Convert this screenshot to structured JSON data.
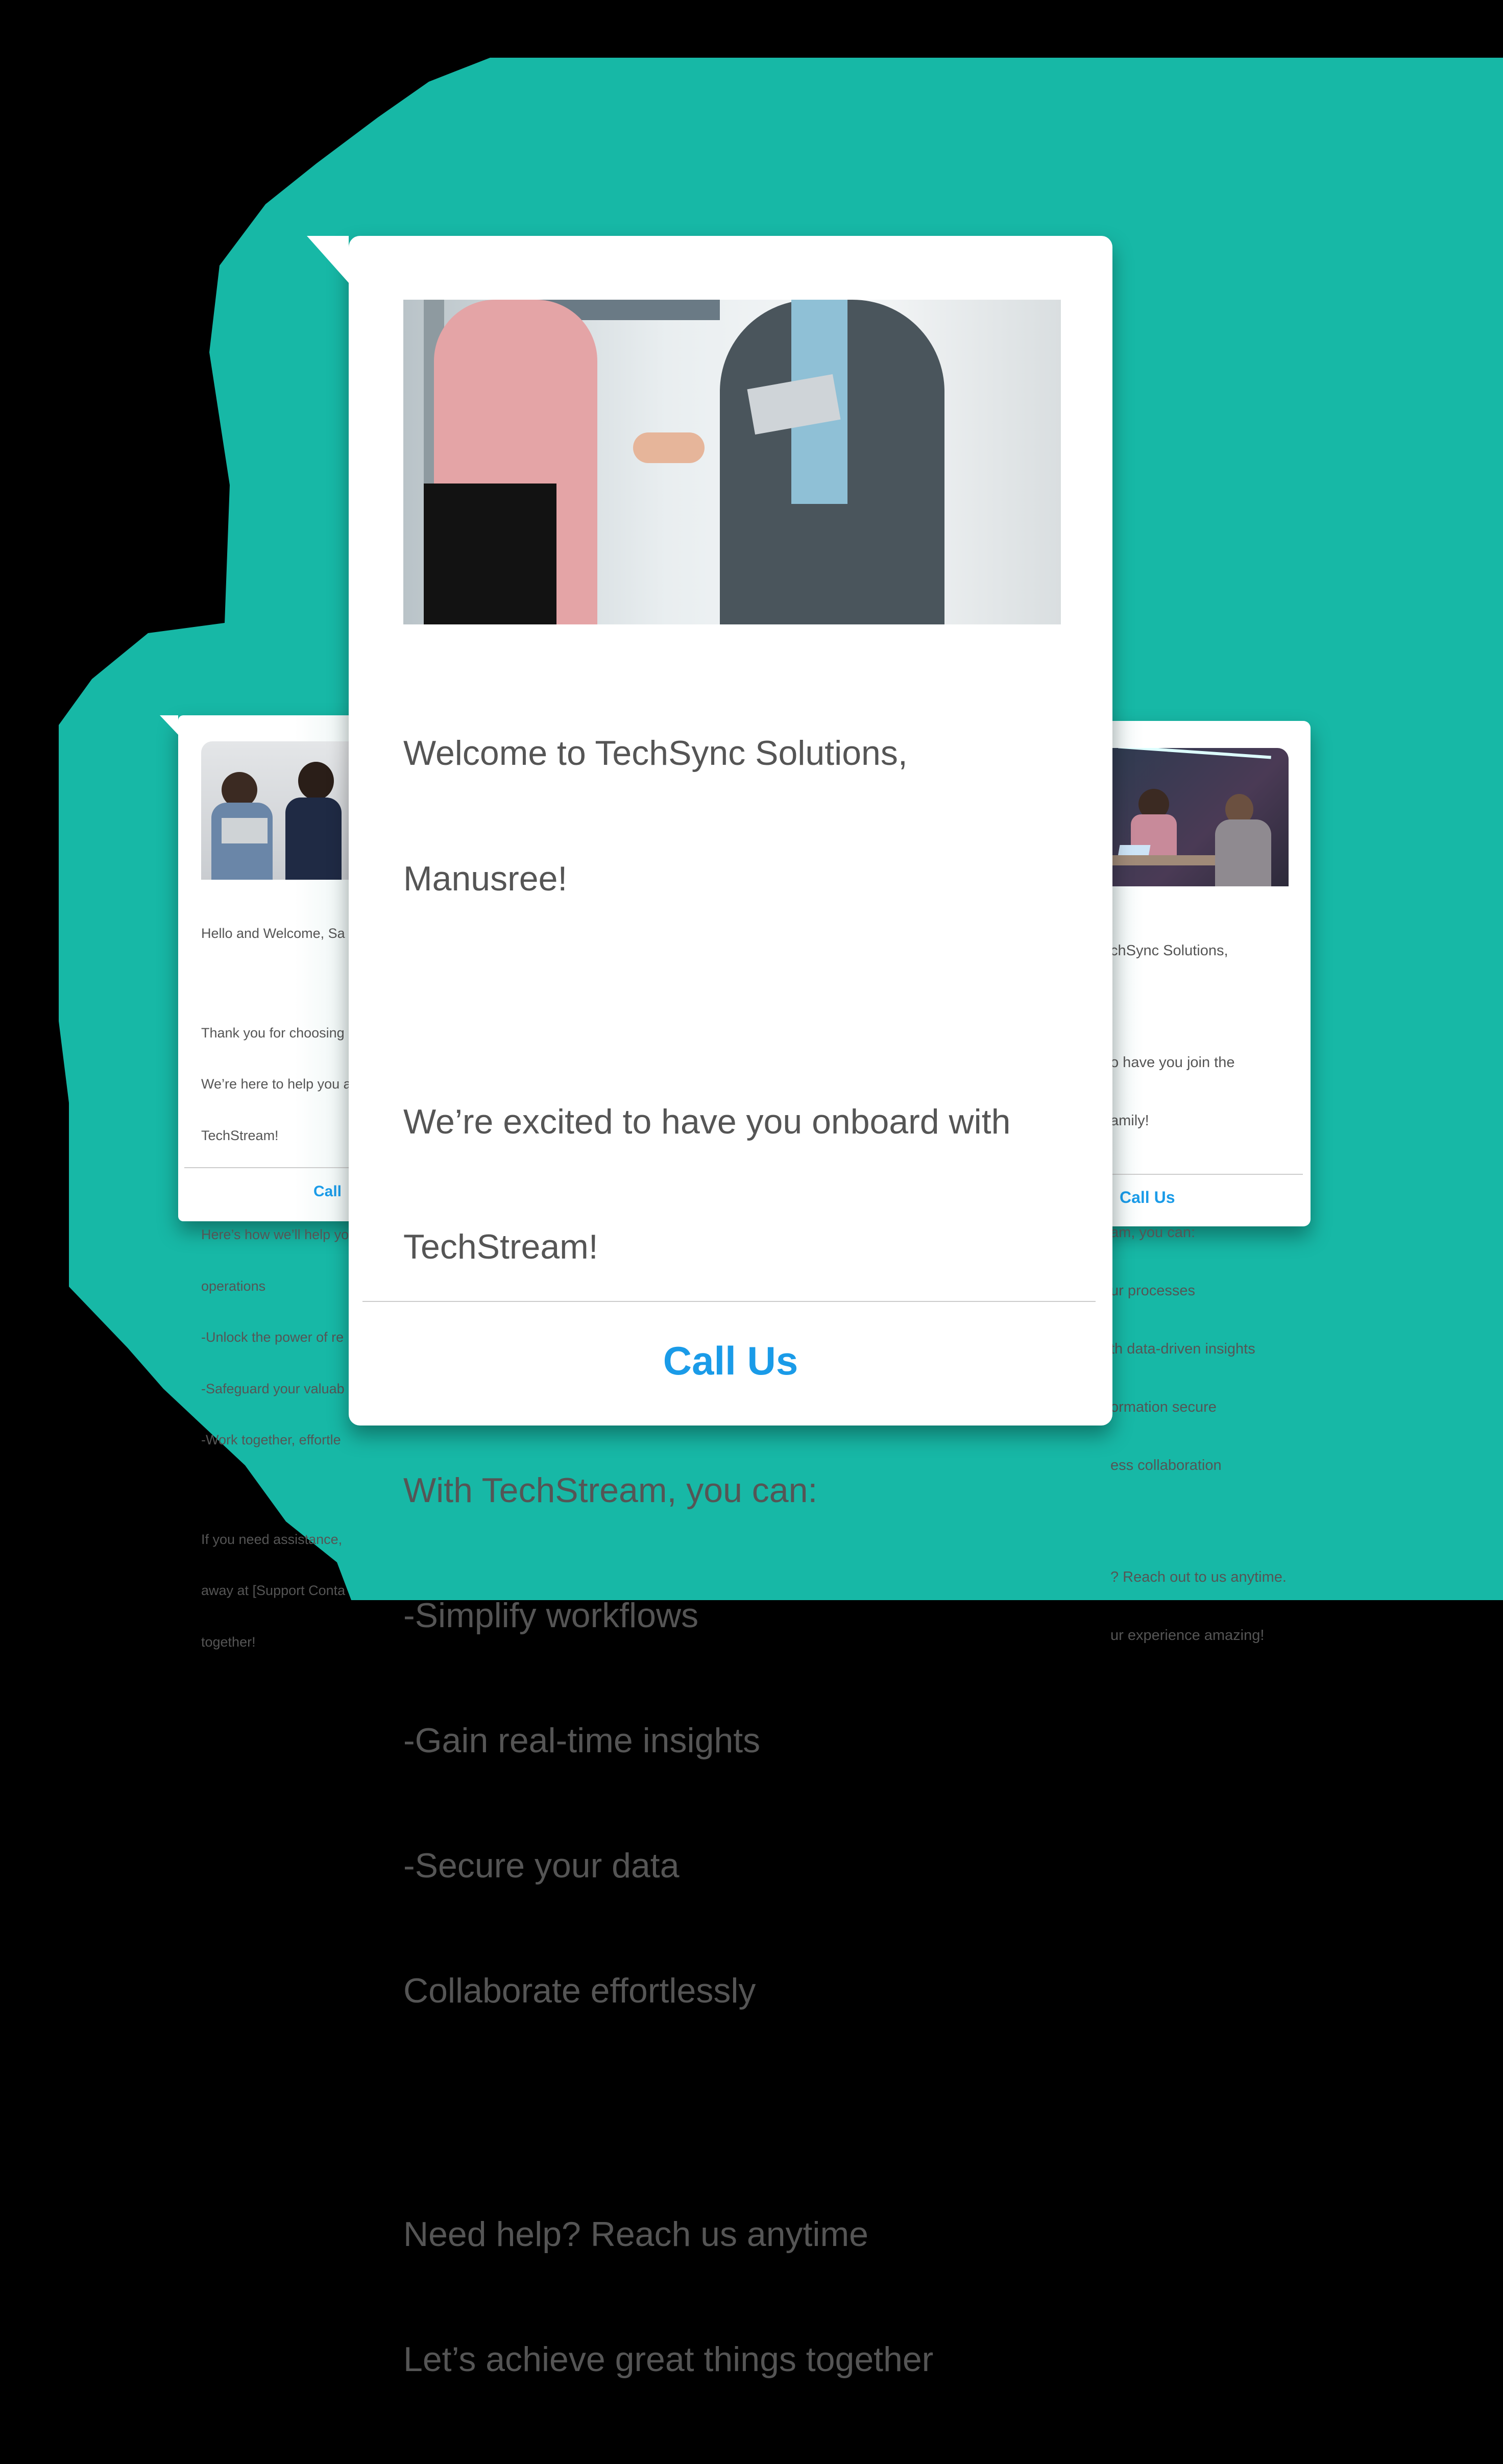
{
  "colors": {
    "teal": "#17b8a6",
    "link": "#1a9be8",
    "text": "#555555",
    "background": "#000000"
  },
  "main_card": {
    "image": "handshake-photo",
    "lines": [
      "Welcome to TechSync Solutions,",
      "Manusree!",
      "",
      "We’re excited to have you onboard with",
      "TechStream!",
      "",
      "With TechStream, you can:",
      "-Simplify workflows",
      "-Gain real-time insights",
      "-Secure your data",
      "Collaborate effortlessly",
      "",
      "Need help? Reach us anytime",
      "Let’s achieve great things together"
    ],
    "cta": "Call Us"
  },
  "left_card": {
    "image": "team-with-laptop-photo",
    "lines": [
      "Hello and Welcome, Sa",
      "",
      "Thank you for choosing",
      "We’re here to help you a",
      "TechStream!",
      "",
      "Here’s how we’ll help yo",
      "operations",
      "-Unlock the power of re",
      "-Safeguard your valuab",
      "-Work together, effortle",
      "",
      "If you need assistance,",
      "away at [Support Conta",
      "together!"
    ],
    "cta": "Call"
  },
  "right_card": {
    "image": "vr-meeting-photo",
    "lines": [
      "chSync Solutions,",
      "",
      "o have you join the",
      "amily!",
      "",
      "am, you can:",
      "ur processes",
      "th data-driven insights",
      "ormation secure",
      "ess collaboration",
      "",
      "? Reach out to us anytime.",
      "ur experience amazing!"
    ],
    "cta": "Call Us"
  }
}
